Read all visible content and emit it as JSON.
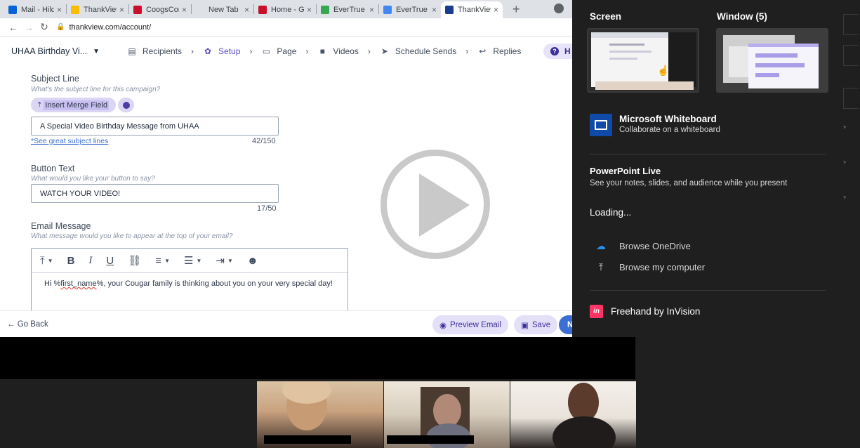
{
  "browser": {
    "tabs": [
      {
        "label": "Mail - Hilde",
        "color": "#0a64d8"
      },
      {
        "label": "ThankView",
        "color": "#fbbc04"
      },
      {
        "label": "CoogsConn",
        "color": "#c8102e"
      },
      {
        "label": "New Tab",
        "color": "#dee1e6"
      },
      {
        "label": "Home - Gir",
        "color": "#c8102e"
      },
      {
        "label": "EverTrue Ur",
        "color": "#34a853"
      },
      {
        "label": "EverTrue",
        "color": "#4285f4"
      },
      {
        "label": "ThankView",
        "color": "#1a3c8c"
      }
    ],
    "active_tab_index": 7,
    "url": "thankview.com/account/"
  },
  "app": {
    "campaign_name": "UHAA Birthday Vi...",
    "steps": [
      "Recipients",
      "Setup",
      "Page",
      "Videos",
      "Schedule Sends",
      "Replies"
    ],
    "active_step": "Setup",
    "help_label": "H"
  },
  "form": {
    "subject": {
      "label": "Subject Line",
      "hint": "What's the subject line for this campaign?",
      "merge_label": "Insert Merge Field",
      "value": "A Special Video Birthday Message from UHAA",
      "counter": "42/150",
      "link": "*See great subject lines"
    },
    "button": {
      "label": "Button Text",
      "hint": "What would you like your button to say?",
      "value": "WATCH YOUR VIDEO!",
      "counter": "17/50"
    },
    "email": {
      "label": "Email Message",
      "hint": "What message would you like to appear at the top of your email?",
      "body_prefix": "Hi %",
      "body_merge": "first_name",
      "body_suffix": "%, your Cougar family is thinking about you on your very special day!"
    }
  },
  "footer": {
    "go_back": "Go Back",
    "preview": "Preview Email",
    "save": "Save",
    "next": "N"
  },
  "share_panel": {
    "screen_title": "Screen",
    "window_title": "Window (5)",
    "whiteboard_name": "Microsoft Whiteboard",
    "whiteboard_desc": "Collaborate on a whiteboard",
    "ppt_title": "PowerPoint Live",
    "ppt_desc": "See your notes, slides, and audience while you present",
    "loading": "Loading...",
    "browse_onedrive": "Browse OneDrive",
    "browse_computer": "Browse my computer",
    "freehand": "Freehand by InVision",
    "freehand_icon_text": "in"
  }
}
